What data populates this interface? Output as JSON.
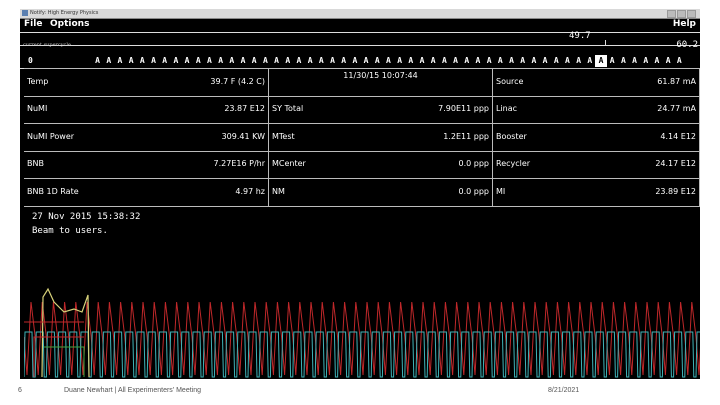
{
  "window": {
    "title": "Notify: High Energy Physics"
  },
  "menu": {
    "file": "File",
    "options": "Options",
    "help": "Help"
  },
  "scale": {
    "small_label": "current supercycle",
    "val_top": "49.7",
    "val_right": "60.2",
    "zero": "0"
  },
  "ticks": [
    "A",
    "A",
    "A",
    "A",
    "A",
    "A",
    "A",
    "A",
    "A",
    "A",
    "A",
    "A",
    "A",
    "A",
    "A",
    "A",
    "A",
    "A",
    "A",
    "A",
    "A",
    "A",
    "A",
    "A",
    "A",
    "A",
    "A",
    "A",
    "A",
    "A",
    "A",
    "A",
    "A",
    "A",
    "A",
    "A",
    "A",
    "A",
    "A",
    "A",
    "A",
    "A",
    "A",
    "A",
    "A",
    "A",
    "A",
    "A",
    "A",
    "A",
    "A",
    "A",
    "A"
  ],
  "highlight_tick_index": 45,
  "grid": {
    "timestamp": "11/30/15 10:07:44",
    "rows": [
      {
        "l_label": "Temp",
        "l_value": "39.7 F (4.2 C)",
        "m_label": "",
        "m_value": "",
        "r_label": "Source",
        "r_value": "61.87 mA"
      },
      {
        "l_label": "NuMI",
        "l_value": "23.87 E12",
        "m_label": "SY Total",
        "m_value": "7.90E11 ppp",
        "r_label": "Linac",
        "r_value": "24.77 mA"
      },
      {
        "l_label": "NuMI Power",
        "l_value": "309.41 KW",
        "m_label": "MTest",
        "m_value": "1.2E11 ppp",
        "r_label": "Booster",
        "r_value": "4.14 E12"
      },
      {
        "l_label": "BNB",
        "l_value": "7.27E16 P/hr",
        "m_label": "MCenter",
        "m_value": "0.0 ppp",
        "r_label": "Recycler",
        "r_value": "24.17 E12"
      },
      {
        "l_label": "BNB 1D Rate",
        "l_value": "4.97 hz",
        "m_label": "NM",
        "m_value": "0.0 ppp",
        "r_label": "MI",
        "r_value": "23.89 E12"
      }
    ]
  },
  "message": {
    "date": "27 Nov 2015 15:38:32",
    "text": "Beam to users."
  },
  "colors": {
    "red_wave": "#c0282a",
    "cyan_wave": "#3fb3b8",
    "yellow_wave": "#d8d27a",
    "green_wave": "#3fa43f"
  },
  "footer": {
    "page": "6",
    "author": "Duane Newhart | All Experimenters' Meeting",
    "date": "8/21/2021"
  }
}
